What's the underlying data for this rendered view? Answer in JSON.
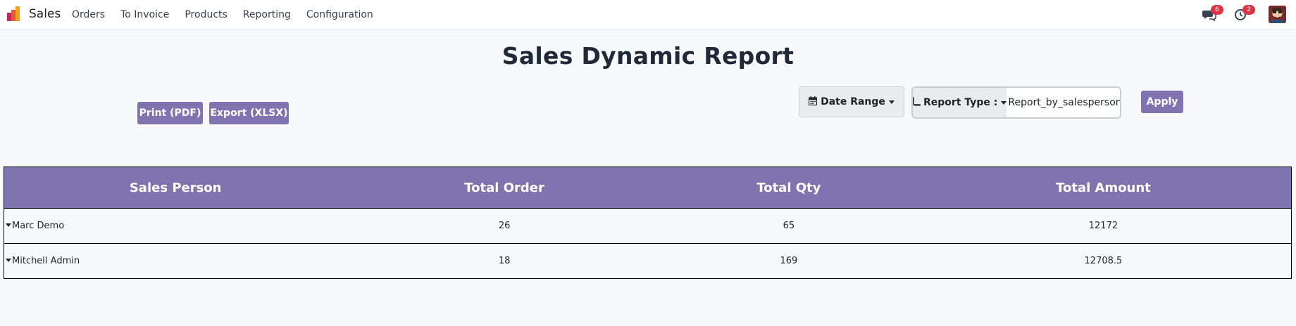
{
  "navbar": {
    "app_name": "Sales",
    "menu": [
      "Orders",
      "To Invoice",
      "Products",
      "Reporting",
      "Configuration"
    ],
    "messages_count": "6",
    "activities_count": "2"
  },
  "report": {
    "title": "Sales Dynamic Report",
    "print_label": "Print (PDF)",
    "export_label": "Export (XLSX)",
    "date_range_label": "Date Range",
    "report_type_label": "Report Type :",
    "report_type_value": "Report_by_salesperson",
    "apply_label": "Apply"
  },
  "table": {
    "headers": [
      "Sales Person",
      "Total Order",
      "Total Qty",
      "Total Amount"
    ],
    "rows": [
      {
        "person": "Marc Demo",
        "orders": "26",
        "qty": "65",
        "amount": "12172"
      },
      {
        "person": "Mitchell Admin",
        "orders": "18",
        "qty": "169",
        "amount": "12708.5"
      }
    ]
  },
  "colors": {
    "accent": "#8074b0",
    "badge": "#dc3545",
    "background": "#f8f9fa"
  }
}
